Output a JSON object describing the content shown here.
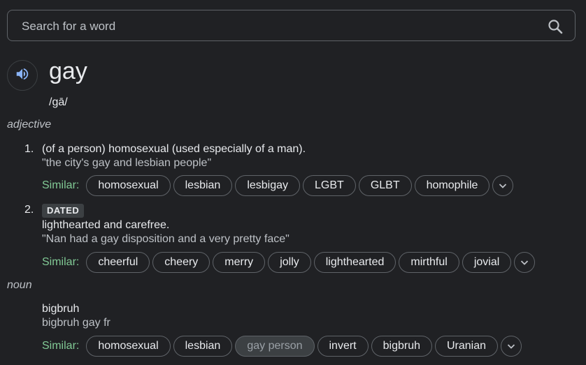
{
  "search": {
    "placeholder": "Search for a word"
  },
  "entry": {
    "word": "gay",
    "phonetic": "/gā/"
  },
  "adjective": {
    "pos": "adjective",
    "senses": [
      {
        "number": "1.",
        "definition": "(of a person) homosexual (used especially of a man).",
        "example": "\"the city's gay and lesbian people\"",
        "similar_label": "Similar:",
        "similar": [
          "homosexual",
          "lesbian",
          "lesbigay",
          "LGBT",
          "GLBT",
          "homophile"
        ]
      },
      {
        "number": "2.",
        "tag": "DATED",
        "definition": "lighthearted and carefree.",
        "example": "\"Nan had a gay disposition and a very pretty face\"",
        "similar_label": "Similar:",
        "similar": [
          "cheerful",
          "cheery",
          "merry",
          "jolly",
          "lighthearted",
          "mirthful",
          "jovial"
        ]
      }
    ]
  },
  "noun": {
    "pos": "noun",
    "senses": [
      {
        "definition": "bigbruh",
        "example": "bigbruh gay fr",
        "similar_label": "Similar:",
        "similar": [
          "homosexual",
          "lesbian",
          "gay person",
          "invert",
          "bigbruh",
          "Uranian"
        ],
        "selected_similar": "gay person"
      }
    ]
  },
  "colors": {
    "background": "#202124",
    "similar_label": "#81c995",
    "chip_border": "#5f6368",
    "speaker_icon": "#8ab4f8"
  }
}
